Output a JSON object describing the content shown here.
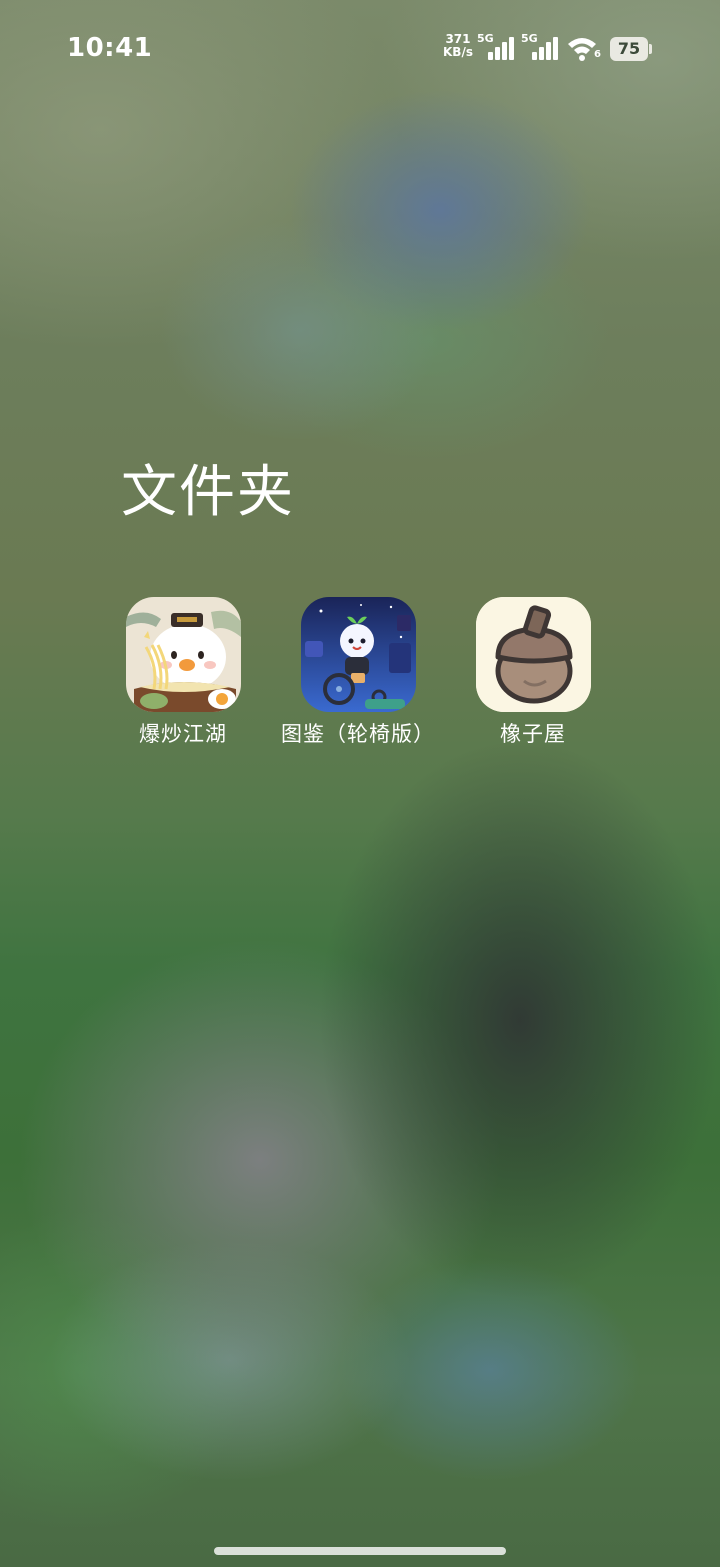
{
  "status_bar": {
    "time": "10:41",
    "net_speed_value": "371",
    "net_speed_unit": "KB/s",
    "signal_1_label": "5G",
    "signal_2_label": "5G",
    "wifi_label": "6",
    "battery_percent": "75"
  },
  "folder": {
    "title": "文件夹",
    "apps": [
      {
        "label": "爆炒江湖",
        "icon": "cartoon-bun-chef-noodles-icon"
      },
      {
        "label": "图鉴（轮椅版）",
        "icon": "cartoon-sprout-wheelchair-icon"
      },
      {
        "label": "橡子屋",
        "icon": "acorn-icon"
      }
    ]
  },
  "colors": {
    "acorn_bg": "#fbf6e3",
    "acorn_body": "#a88e7b",
    "acorn_outline": "#3e3634",
    "game2_bg": "#1d2e6a"
  }
}
